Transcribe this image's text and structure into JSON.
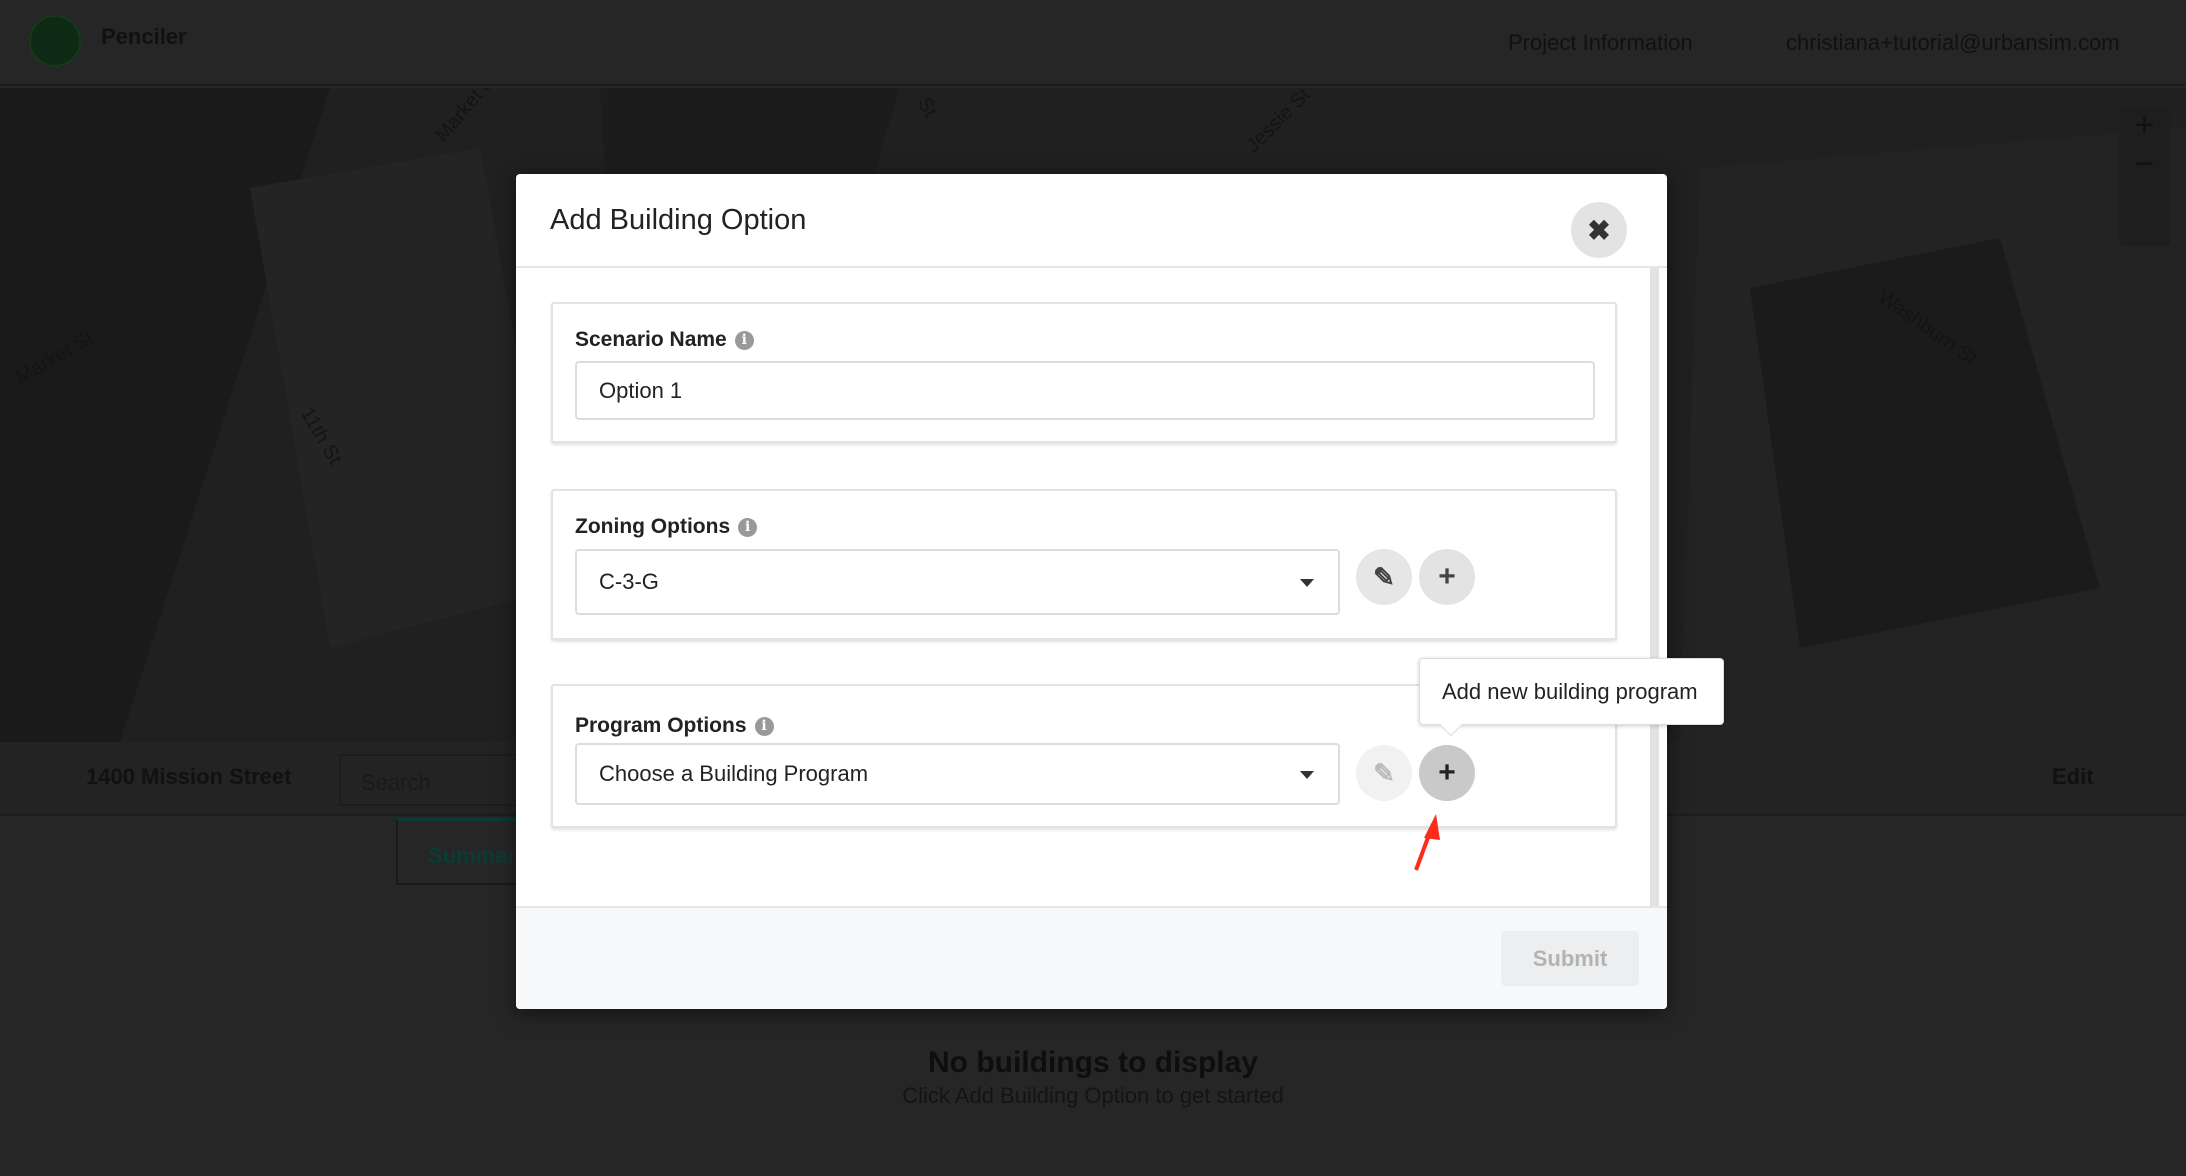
{
  "app": {
    "name": "Penciler",
    "brand_color": "#1f5a2c"
  },
  "topnav": {
    "project_info": "Project Information",
    "user": "christiana+tutorial@urbansim.com"
  },
  "map": {
    "labels": [
      "Market St",
      "Jessie St",
      "11th St",
      "Market St",
      "Washburn St",
      "St"
    ]
  },
  "panel": {
    "address": "1400 Mission Street",
    "search_placeholder": "Search",
    "edit": "Edit",
    "tab_summary": "Summary",
    "empty_title": "No buildings to display",
    "empty_subtitle": "Click Add Building Option to get started"
  },
  "modal": {
    "title": "Add Building Option",
    "scenario": {
      "label": "Scenario Name",
      "value": "Option 1"
    },
    "zoning": {
      "label": "Zoning Options",
      "value": "C-3-G"
    },
    "program": {
      "label": "Program Options",
      "value": "Choose a Building Program"
    },
    "tooltip": "Add new building program",
    "submit": "Submit"
  },
  "annotation_color": "#ff2a1a"
}
